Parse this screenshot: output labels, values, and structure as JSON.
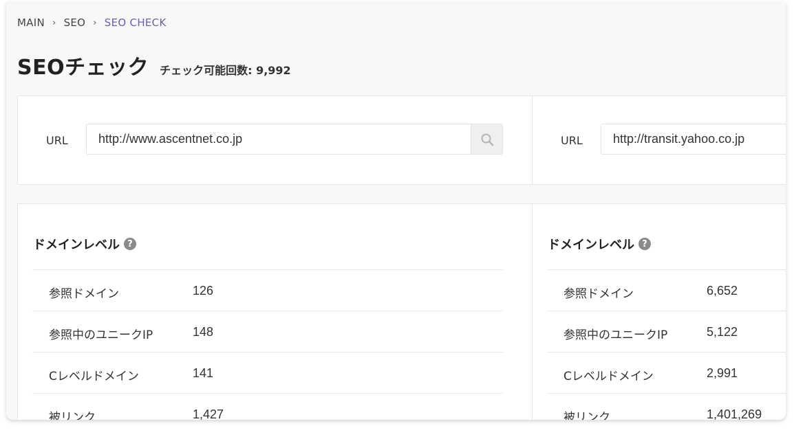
{
  "breadcrumb": {
    "items": [
      "MAIN",
      "SEO",
      "SEO CHECK"
    ],
    "separator": "›"
  },
  "header": {
    "title": "SEOチェック",
    "remaining": "チェック可能回数: 9,992"
  },
  "left": {
    "url_label": "URL",
    "url_value": "http://www.ascentnet.co.jp",
    "section_title": "ドメインレベル",
    "help": "?",
    "metrics": [
      {
        "label": "参照ドメイン",
        "value": "126"
      },
      {
        "label": "参照中のユニークIP",
        "value": "148"
      },
      {
        "label": "Cレベルドメイン",
        "value": "141"
      },
      {
        "label": "被リンク",
        "value": "1,427"
      }
    ]
  },
  "right": {
    "url_label": "URL",
    "url_value": "http://transit.yahoo.co.jp",
    "section_title": "ドメインレベル",
    "help": "?",
    "metrics": [
      {
        "label": "参照ドメイン",
        "value": "6,652"
      },
      {
        "label": "参照中のユニークIP",
        "value": "5,122"
      },
      {
        "label": "Cレベルドメイン",
        "value": "2,991"
      },
      {
        "label": "被リンク",
        "value": "1,401,269"
      }
    ]
  },
  "icons": {
    "search": "search-icon",
    "help": "help-circle-icon"
  },
  "colors": {
    "accent": "#6a5fa8",
    "background": "#f8f8f8"
  }
}
